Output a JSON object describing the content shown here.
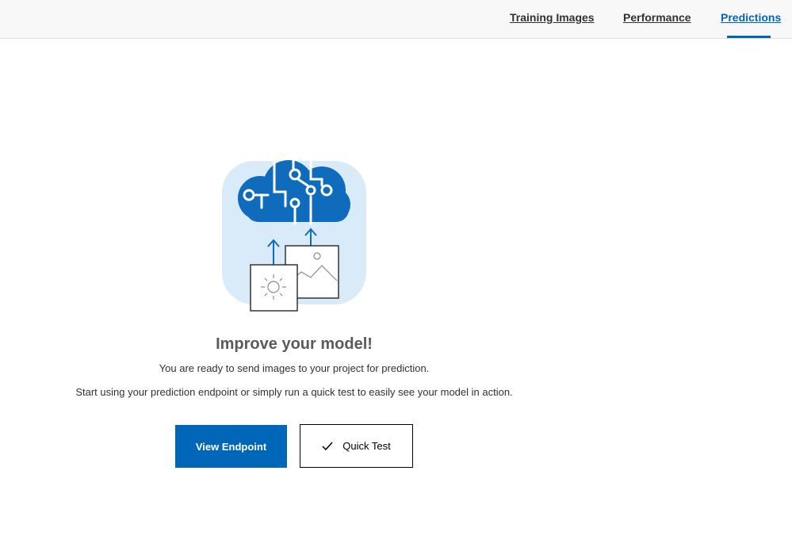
{
  "nav": {
    "tabs": [
      {
        "label": "Training Images",
        "active": false
      },
      {
        "label": "Performance",
        "active": false
      },
      {
        "label": "Predictions",
        "active": true
      }
    ]
  },
  "empty_state": {
    "illustration_icon": "brain-cloud-images-illustration",
    "heading": "Improve your model!",
    "line1": "You are ready to send images to your project for prediction.",
    "line2": "Start using your prediction endpoint or simply run a quick test to easily see your model in action."
  },
  "actions": {
    "view_endpoint_label": "View Endpoint",
    "quick_test_label": "Quick Test",
    "quick_test_icon": "checkmark-icon"
  },
  "colors": {
    "accent": "#0067b8",
    "topbar_bg": "#f8f8f8",
    "illustration_bg": "#d9eaf8",
    "brain_blue": "#0f6cbd"
  }
}
